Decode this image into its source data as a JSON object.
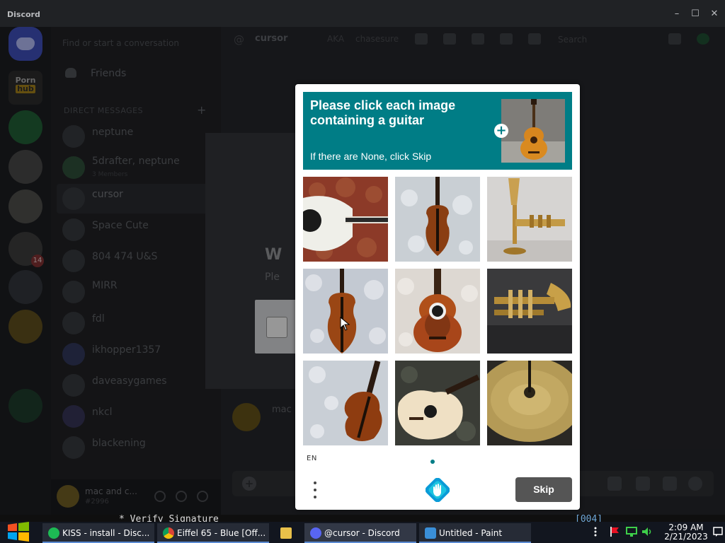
{
  "window": {
    "app_name": "Discord"
  },
  "servers": [
    {
      "name": "home"
    },
    {
      "label": "Porn",
      "label2": "hub"
    },
    {
      "name": "server-3"
    },
    {
      "name": "server-4"
    },
    {
      "name": "server-5"
    },
    {
      "name": "server-6",
      "badge": "14"
    },
    {
      "name": "server-7"
    },
    {
      "name": "server-8"
    }
  ],
  "dm_panel": {
    "search_placeholder": "Find or start a conversation",
    "friends_label": "Friends",
    "direct_messages_header": "DIRECT MESSAGES",
    "items": [
      {
        "name": "neptune",
        "sub": ""
      },
      {
        "name": "5drafter, neptune",
        "sub": "3 Members"
      },
      {
        "name": "cursor",
        "sub": ""
      },
      {
        "name": "Space Cute",
        "sub": ""
      },
      {
        "name": "804 474 U&S",
        "sub": ""
      },
      {
        "name": "MIRR",
        "sub": ""
      },
      {
        "name": "fdl",
        "sub": ""
      },
      {
        "name": "ikhopper1357",
        "sub": ""
      },
      {
        "name": "daveasygames",
        "sub": ""
      },
      {
        "name": "nkcl",
        "sub": ""
      },
      {
        "name": "blackening",
        "sub": ""
      }
    ],
    "user": {
      "name": "mac and c...",
      "tag": "#2996"
    }
  },
  "chat": {
    "channel_name": "cursor",
    "header_extra_1": "AKA",
    "header_extra_2": "chasesure",
    "search_placeholder": "Search",
    "verify_heading": "W",
    "verify_sub": "Ple",
    "message_author": "mac"
  },
  "captcha": {
    "prompt_title": "Please click each image containing a guitar",
    "prompt_sub": "If there are None, click Skip",
    "lang": "EN",
    "skip_label": "Skip",
    "accent_color": "#007d86",
    "tiles": [
      {
        "subject": "acoustic guitar white",
        "contains_guitar": true
      },
      {
        "subject": "violin",
        "contains_guitar": false
      },
      {
        "subject": "trumpet",
        "contains_guitar": false
      },
      {
        "subject": "violin",
        "contains_guitar": false
      },
      {
        "subject": "acoustic guitar sunburst",
        "contains_guitar": true
      },
      {
        "subject": "trumpet",
        "contains_guitar": false
      },
      {
        "subject": "violin",
        "contains_guitar": false
      },
      {
        "subject": "acoustic guitar cream",
        "contains_guitar": true
      },
      {
        "subject": "cymbal",
        "contains_guitar": false
      }
    ]
  },
  "terminal": {
    "line_left": "* Verify Signature",
    "line_right": "[004]"
  },
  "taskbar": {
    "items": [
      {
        "label": "KISS - install - Disc..."
      },
      {
        "label": "Eiffel 65 - Blue  [Off..."
      },
      {
        "label": ""
      },
      {
        "label": "@cursor - Discord"
      },
      {
        "label": "Untitled - Paint"
      }
    ],
    "clock_time": "2:09 AM",
    "clock_date": "2/21/2023"
  }
}
